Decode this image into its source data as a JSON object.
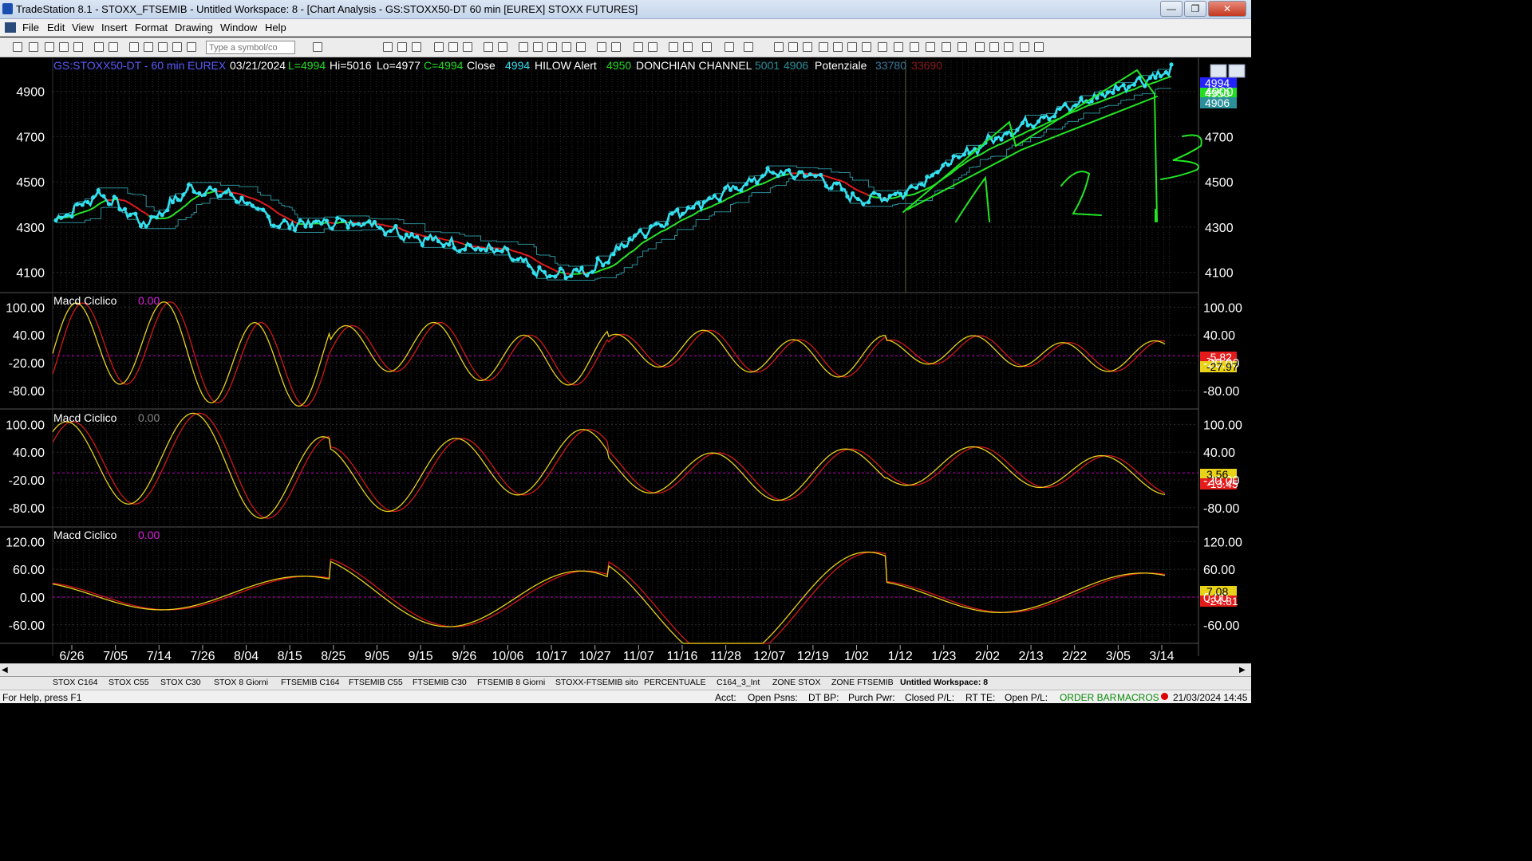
{
  "window": {
    "title": "TradeStation 8.1 - STOXX_FTSEMIB - Untitled Workspace:  8 - [Chart Analysis - GS:STOXX50-DT  60 min  [EUREX] STOXX FUTURES]",
    "min_label": "—",
    "max_label": "❐",
    "close_label": "✕"
  },
  "menu": [
    "File",
    "Edit",
    "View",
    "Insert",
    "Format",
    "Drawing",
    "Window",
    "Help"
  ],
  "toolbar": {
    "symbol_placeholder": "Type a symbol/co"
  },
  "chart_header": {
    "symbol": "GS:STOXX50-DT - 60 min",
    "exchange": "EUREX",
    "date": "03/21/2024",
    "last": "L=4994",
    "hi": "Hi=5016",
    "lo": "Lo=4977",
    "close_val": "C=4994",
    "close_label": "Close",
    "close_num": "4994",
    "hilow": "HILOW Alert",
    "hilow_num": "4950",
    "donchian": "DONCHIAN CHANNEL",
    "donchian_hi": "5001",
    "donchian_lo": "4906",
    "potenziale": "Potenziale",
    "pot1": "33780",
    "pot2": "33690"
  },
  "panel_titles": [
    {
      "name": "Macd Ciclico",
      "value": "0.00"
    },
    {
      "name": "Macd Ciclico",
      "value": "0.00"
    },
    {
      "name": "Macd Ciclico",
      "value": "0.00"
    }
  ],
  "colors": {
    "price": "#33e0f0",
    "hilow_red": "#e31b1b",
    "hilow_green": "#28ea28",
    "channel": "#2a8f99",
    "fast": "#e8d21a",
    "slow": "#d01818",
    "zero": "#c000c0",
    "hand": "#22e622",
    "header_blue": "#5a5aff",
    "header_green": "#22dd22"
  },
  "chart_data": [
    {
      "type": "line",
      "panel": "price",
      "yticks": [
        4100,
        4300,
        4500,
        4700,
        4900
      ],
      "ylim": [
        4010,
        5040
      ],
      "x": [
        "6/26",
        "7/05",
        "7/14",
        "7/26",
        "8/04",
        "8/15",
        "8/25",
        "9/05",
        "9/15",
        "9/26",
        "10/06",
        "10/17",
        "10/27",
        "11/07",
        "11/16",
        "11/28",
        "12/07",
        "12/19",
        "1/02",
        "1/12",
        "1/23",
        "2/02",
        "2/13",
        "2/22",
        "3/05",
        "3/14"
      ],
      "close": [
        4330,
        4450,
        4310,
        4470,
        4440,
        4310,
        4320,
        4320,
        4260,
        4220,
        4190,
        4080,
        4110,
        4260,
        4370,
        4450,
        4540,
        4530,
        4420,
        4450,
        4580,
        4690,
        4780,
        4850,
        4930,
        4990
      ],
      "markers": [
        {
          "label": "4994",
          "color": "#2323ff"
        },
        {
          "label": "4950",
          "color": "#22dd22"
        },
        {
          "label": "4906",
          "color": "#2a8f99"
        }
      ]
    },
    {
      "type": "line",
      "panel": "macd1",
      "yticks": [
        "100.00",
        "40.00",
        "-20.00",
        "-80.00"
      ],
      "ylim": [
        -120,
        130
      ],
      "markers": [
        {
          "label": "-5.82",
          "color": "#e31b1b"
        },
        {
          "label": "-27.97",
          "color": "#e8d21a"
        }
      ]
    },
    {
      "type": "line",
      "panel": "macd2",
      "yticks": [
        "100.00",
        "40.00",
        "-20.00",
        "-80.00"
      ],
      "ylim": [
        -120,
        130
      ],
      "markers": [
        {
          "label": "3.56",
          "color": "#e8d21a"
        },
        {
          "label": "-13.45",
          "color": "#e31b1b"
        }
      ]
    },
    {
      "type": "line",
      "panel": "macd3",
      "yticks": [
        "120.00",
        "60.00",
        "0.00",
        "-60.00"
      ],
      "ylim": [
        -100,
        150
      ],
      "markers": [
        {
          "label": "7.08",
          "color": "#e8d21a"
        },
        {
          "label": "-24.81",
          "color": "#e31b1b"
        }
      ]
    }
  ],
  "tabs": [
    "STOX C164",
    "STOX C55",
    "STOX  C30",
    "STOX  8 Giorni",
    "FTSEMIB C164",
    "FTSEMIB C55",
    "FTSEMIB C30",
    "FTSEMIB  8 Giorni",
    "STOXX-FTSEMIB sito",
    "PERCENTUALE",
    "C164_3_Int",
    "ZONE STOX",
    "ZONE FTSEMIB",
    "Untitled Workspace:  8"
  ],
  "status": {
    "help": "For Help, press F1",
    "acct": "Acct:",
    "open_psns": "Open Psns:",
    "dt_bp": "DT BP:",
    "purch": "Purch Pwr:",
    "closed": "Closed P/L:",
    "rt": "RT TE:",
    "open_pl": "Open P/L:",
    "order_bar": "ORDER BAR",
    "macros": "MACROS",
    "datetime": "21/03/2024 14:45"
  }
}
